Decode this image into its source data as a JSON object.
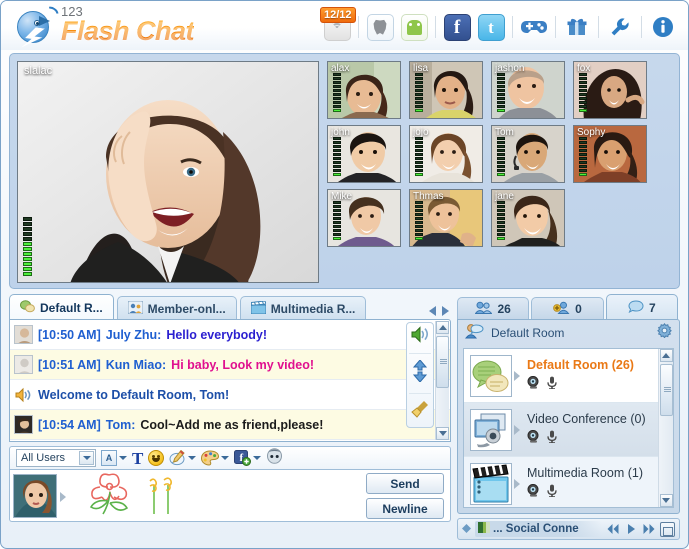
{
  "app": {
    "brand_small": "123",
    "brand_main": "Flash Chat",
    "accent_orange": "#ef7a0c",
    "accent_blue": "#1f5fd0"
  },
  "toolbar": {
    "badge": "12/12",
    "items": [
      {
        "name": "wifi-icon",
        "label": "Connection"
      },
      {
        "name": "apple-icon",
        "label": "iOS App"
      },
      {
        "name": "android-icon",
        "label": "Android App"
      },
      {
        "name": "facebook-icon",
        "label": "f"
      },
      {
        "name": "twitter-icon",
        "label": "t"
      },
      {
        "name": "game-controller-icon",
        "label": "Games"
      },
      {
        "name": "gift-icon",
        "label": "Gifts"
      },
      {
        "name": "wrench-icon",
        "label": "Settings"
      },
      {
        "name": "info-icon",
        "label": "About"
      }
    ]
  },
  "video": {
    "main": {
      "name": "slalac",
      "meter_on": 7,
      "meter_total": 12
    },
    "thumbs": [
      {
        "name": "alax",
        "meter_on": 1
      },
      {
        "name": "lisa",
        "meter_on": 1
      },
      {
        "name": "jashon",
        "meter_on": 1
      },
      {
        "name": "fox",
        "meter_on": 1
      },
      {
        "name": "john",
        "meter_on": 1
      },
      {
        "name": "jojo",
        "meter_on": 1
      },
      {
        "name": "Tom",
        "meter_on": 1
      },
      {
        "name": "Sophy",
        "meter_on": 1
      },
      {
        "name": "Mike",
        "meter_on": 1
      },
      {
        "name": "Thmas",
        "meter_on": 1
      },
      {
        "name": "jane",
        "meter_on": 1
      }
    ]
  },
  "chat": {
    "tabs": [
      {
        "label": "Default R...",
        "icon": "speech-bubbles-icon",
        "active": true
      },
      {
        "label": "Member-onl...",
        "icon": "members-icon",
        "active": false
      },
      {
        "label": "Multimedia R...",
        "icon": "clapper-board-icon",
        "active": false
      }
    ],
    "messages": [
      {
        "time": "[10:50 AM]",
        "user": "July Zhu:",
        "body": "Hello everybody!",
        "style": "blue",
        "alt": false,
        "icon": "avatar"
      },
      {
        "time": "[10:51 AM]",
        "user": "Kun Miao:",
        "body": "Hi baby, Look my video!",
        "style": "pink",
        "alt": true,
        "icon": "avatar"
      },
      {
        "time": "",
        "user": "",
        "body": "Welcome to Default Room, Tom!",
        "style": "system",
        "alt": false,
        "icon": "speaker"
      },
      {
        "time": "[10:54 AM]",
        "user": "Tom:",
        "body": "Cool~Add me as friend,please!",
        "style": "dark",
        "alt": true,
        "icon": "avatar"
      }
    ],
    "side_tools": [
      {
        "name": "sound-icon",
        "label": "Sound"
      },
      {
        "name": "scroll-updown-icon",
        "label": "Auto scroll"
      },
      {
        "name": "broom-icon",
        "label": "Clear chat"
      }
    ]
  },
  "input": {
    "recipient": "All Users",
    "tools": [
      {
        "name": "font-picker",
        "label": "A"
      },
      {
        "name": "text-format-icon",
        "label": "T"
      },
      {
        "name": "emoticon-icon",
        "label": "Emoticons"
      },
      {
        "name": "draw-pencil-icon",
        "label": "Draw"
      },
      {
        "name": "color-palette-icon",
        "label": "Colors"
      },
      {
        "name": "facebook-share-icon",
        "label": "Share to Facebook"
      },
      {
        "name": "avatar-icon",
        "label": "Avatar"
      }
    ],
    "send_label": "Send",
    "newline_label": "Newline"
  },
  "right": {
    "tabs": [
      {
        "icon": "users-icon",
        "count": "26",
        "active": false
      },
      {
        "icon": "add-user-icon",
        "count": "0",
        "active": false
      },
      {
        "icon": "chat-bubble-icon",
        "count": "7",
        "active": true
      }
    ],
    "header_title": "Default Room",
    "gear_label": "Room settings",
    "rooms": [
      {
        "name": "Default Room",
        "count": "(26)",
        "active": true,
        "icon": "speech-bubbles-icon",
        "cam": true,
        "mic": true
      },
      {
        "name": "Video Conference",
        "count": "(0)",
        "active": false,
        "icon": "video-conference-icon",
        "cam": true,
        "mic": true
      },
      {
        "name": "Multimedia Room",
        "count": "(1)",
        "active": false,
        "icon": "clapper-board-icon",
        "cam": true,
        "mic": true
      }
    ]
  },
  "statusbar": {
    "label": "... Social Conne",
    "buttons": [
      {
        "name": "prev-fast-button",
        "glyph": "«"
      },
      {
        "name": "play-button",
        "glyph": "▶"
      },
      {
        "name": "next-fast-button",
        "glyph": "»"
      },
      {
        "name": "restore-window-button",
        "glyph": ""
      }
    ]
  }
}
